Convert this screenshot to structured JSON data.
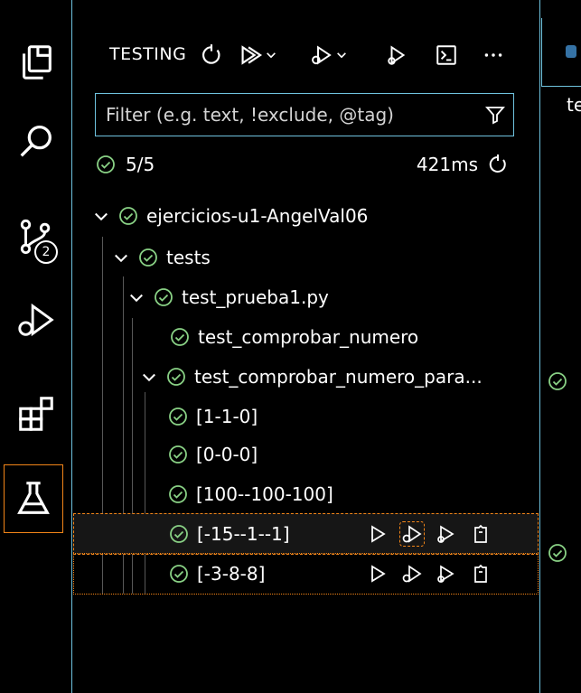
{
  "activity_bar": {
    "items": [
      {
        "name": "explorer-icon"
      },
      {
        "name": "search-icon"
      },
      {
        "name": "source-control-icon",
        "badge": "2"
      },
      {
        "name": "run-debug-icon"
      },
      {
        "name": "extensions-icon"
      },
      {
        "name": "testing-icon",
        "active": true
      }
    ]
  },
  "sidebar": {
    "title": "TESTING",
    "actions": [
      "refresh-icon",
      "run-all-tests-icon",
      "debug-all-tests-icon",
      "run-with-coverage-icon",
      "show-output-icon",
      "more-actions-icon"
    ]
  },
  "filter": {
    "placeholder": "Filter (e.g. text, !exclude, @tag)",
    "value": ""
  },
  "summary": {
    "count": "5/5",
    "time": "421ms"
  },
  "tree": [
    {
      "label": "ejercicios-u1-AngelVal06",
      "level": 0,
      "expanded": true
    },
    {
      "label": "tests",
      "level": 1,
      "expanded": true
    },
    {
      "label": "test_prueba1.py",
      "level": 2,
      "expanded": true
    },
    {
      "label": "test_comprobar_numero",
      "level": 3
    },
    {
      "label": "test_comprobar_numero_para...",
      "level": 3,
      "expanded": true
    },
    {
      "label": "[1-1-0]",
      "level": 4
    },
    {
      "label": "[0-0-0]",
      "level": 4
    },
    {
      "label": "[100--100-100]",
      "level": 4
    },
    {
      "label": "[-15--1--1]",
      "level": 4,
      "focused": true
    },
    {
      "label": "[-3-8-8]",
      "level": 4,
      "selected": true
    }
  ],
  "editor": {
    "tab_text": "te"
  },
  "colors": {
    "accent_border": "#6fc3df",
    "focus_border": "#f38518",
    "pass": "#89d185"
  }
}
